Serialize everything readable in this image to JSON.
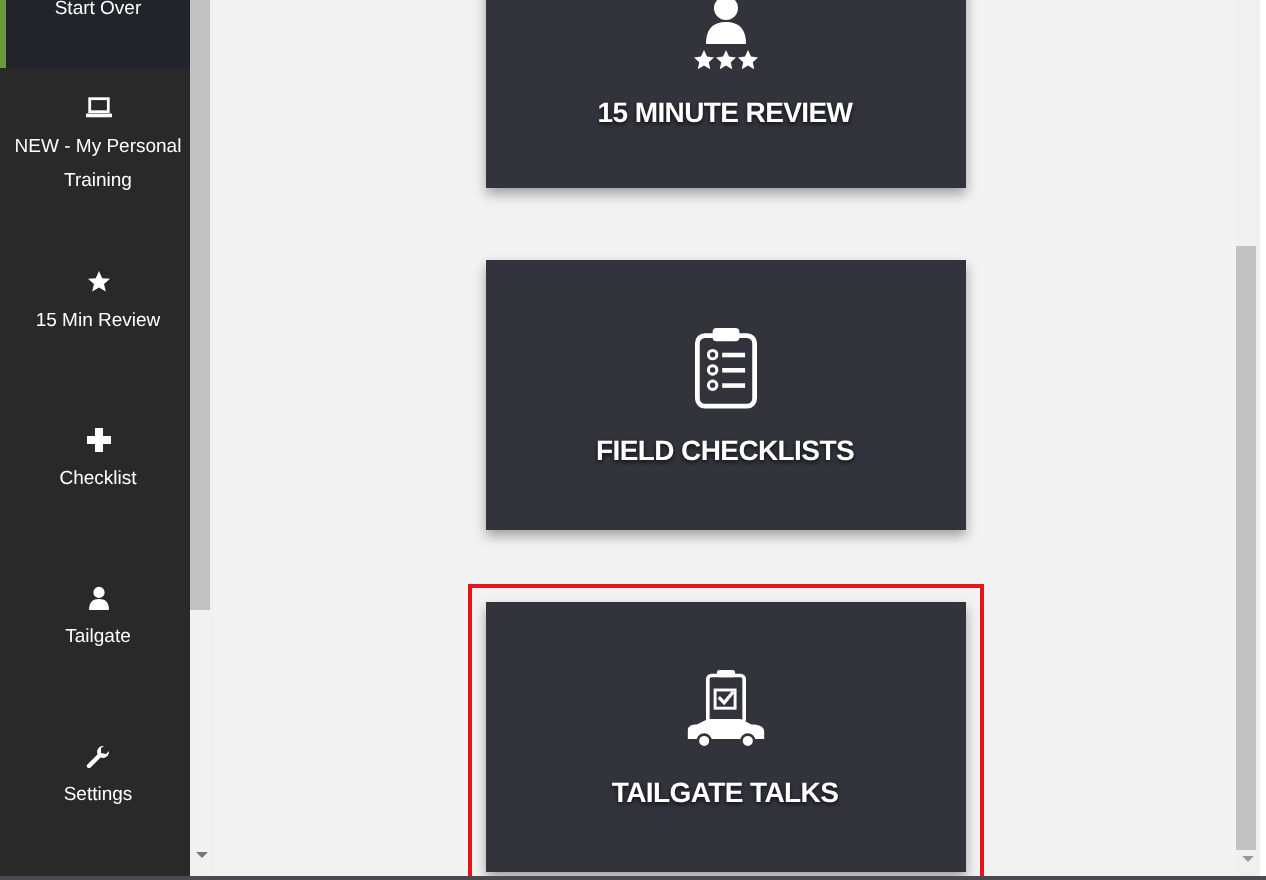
{
  "sidebar": {
    "items": [
      {
        "kind": "none",
        "label": "Start Over",
        "selected": true
      },
      {
        "kind": "laptop",
        "label": "NEW - My Personal Training",
        "selected": false
      },
      {
        "kind": "star",
        "label": "15 Min Review",
        "selected": false
      },
      {
        "kind": "plus",
        "label": "Checklist",
        "selected": false
      },
      {
        "kind": "person",
        "label": "Tailgate",
        "selected": false
      },
      {
        "kind": "wrench",
        "label": "Settings",
        "selected": false
      }
    ]
  },
  "tiles": [
    {
      "kind": "review",
      "label": "15 MINUTE REVIEW",
      "selected": false
    },
    {
      "kind": "checklist",
      "label": "FIELD CHECKLISTS",
      "selected": false
    },
    {
      "kind": "tailgate",
      "label": "TAILGATE TALKS",
      "selected": true
    }
  ]
}
